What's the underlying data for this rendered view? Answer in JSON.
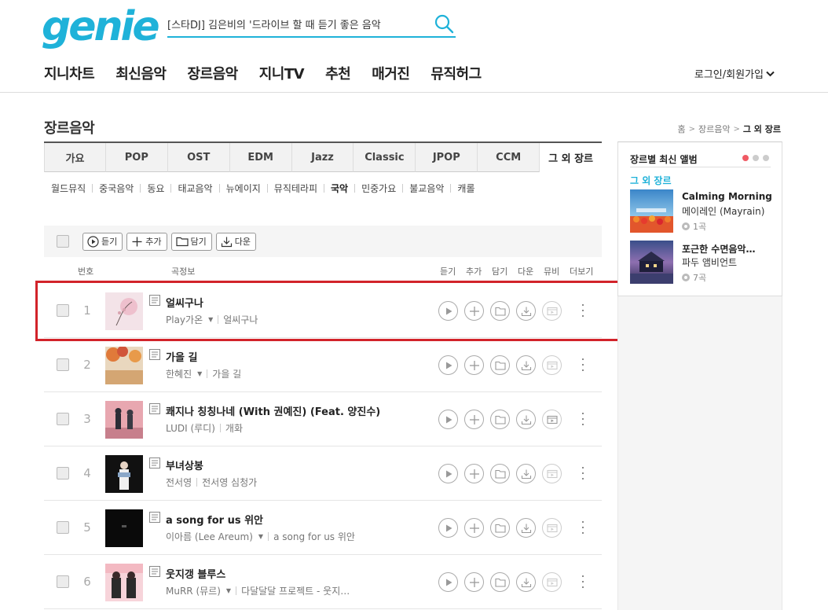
{
  "header": {
    "logo": "genie",
    "search_value": "[스타DJ] 김은비의 '드라이브 할 때 듣기 좋은 음악",
    "nav": [
      "지니차트",
      "최신음악",
      "장르음악",
      "지니TV",
      "추천",
      "매거진",
      "뮤직허그"
    ],
    "login": "로그인/회원가입"
  },
  "page": {
    "title": "장르음악",
    "breadcrumb": [
      "홈",
      "장르음악",
      "그 외 장르"
    ]
  },
  "tabs": [
    "가요",
    "POP",
    "OST",
    "EDM",
    "Jazz",
    "Classic",
    "JPOP",
    "CCM",
    "그 외 장르"
  ],
  "subgenres": [
    "월드뮤직",
    "중국음악",
    "동요",
    "태교음악",
    "뉴에이지",
    "뮤직테라피",
    "국악",
    "민중가요",
    "불교음악",
    "캐롤"
  ],
  "actions": {
    "play": "듣기",
    "add": "추가",
    "save": "담기",
    "download": "다운"
  },
  "columns": {
    "number": "번호",
    "info": "곡정보",
    "play": "듣기",
    "add": "추가",
    "save": "담기",
    "download": "다운",
    "video": "뮤비",
    "more": "더보기"
  },
  "songs": [
    {
      "no": "1",
      "title": "얼씨구나",
      "artist": "Play가온",
      "album": "얼씨구나",
      "has_dropdown": true
    },
    {
      "no": "2",
      "title": "가을 길",
      "artist": "한혜진",
      "album": "가을 길",
      "has_dropdown": true
    },
    {
      "no": "3",
      "title": "쾌지나 칭칭나네 (With 권예진) (Feat. 양진수)",
      "artist": "LUDI (루디)",
      "album": "개화",
      "has_dropdown": false
    },
    {
      "no": "4",
      "title": "부녀상봉",
      "artist": "전서영",
      "album": "전서영 심청가",
      "has_dropdown": false
    },
    {
      "no": "5",
      "title": "a song for us 위안",
      "artist": "이아름 (Lee Areum)",
      "album": "a song for us 위안",
      "has_dropdown": true
    },
    {
      "no": "6",
      "title": "웃지갱 블루스",
      "artist": "MuRR (뮤르)",
      "album": "다달달달 프로젝트 - 웃지…",
      "has_dropdown": true
    }
  ],
  "side": {
    "title": "장르별 최신 앨범",
    "genre": "그 외 장르",
    "albums": [
      {
        "title": "Calming Morning",
        "artist": "메이레인 (Mayrain)",
        "count": "1곡"
      },
      {
        "title": "포근한 수면음악…",
        "artist": "파두 앰비언트",
        "count": "7곡"
      }
    ]
  },
  "colors": {
    "brand": "#1fb2d9",
    "highlight": "#d2232a",
    "dot_active": "#f05a64"
  }
}
